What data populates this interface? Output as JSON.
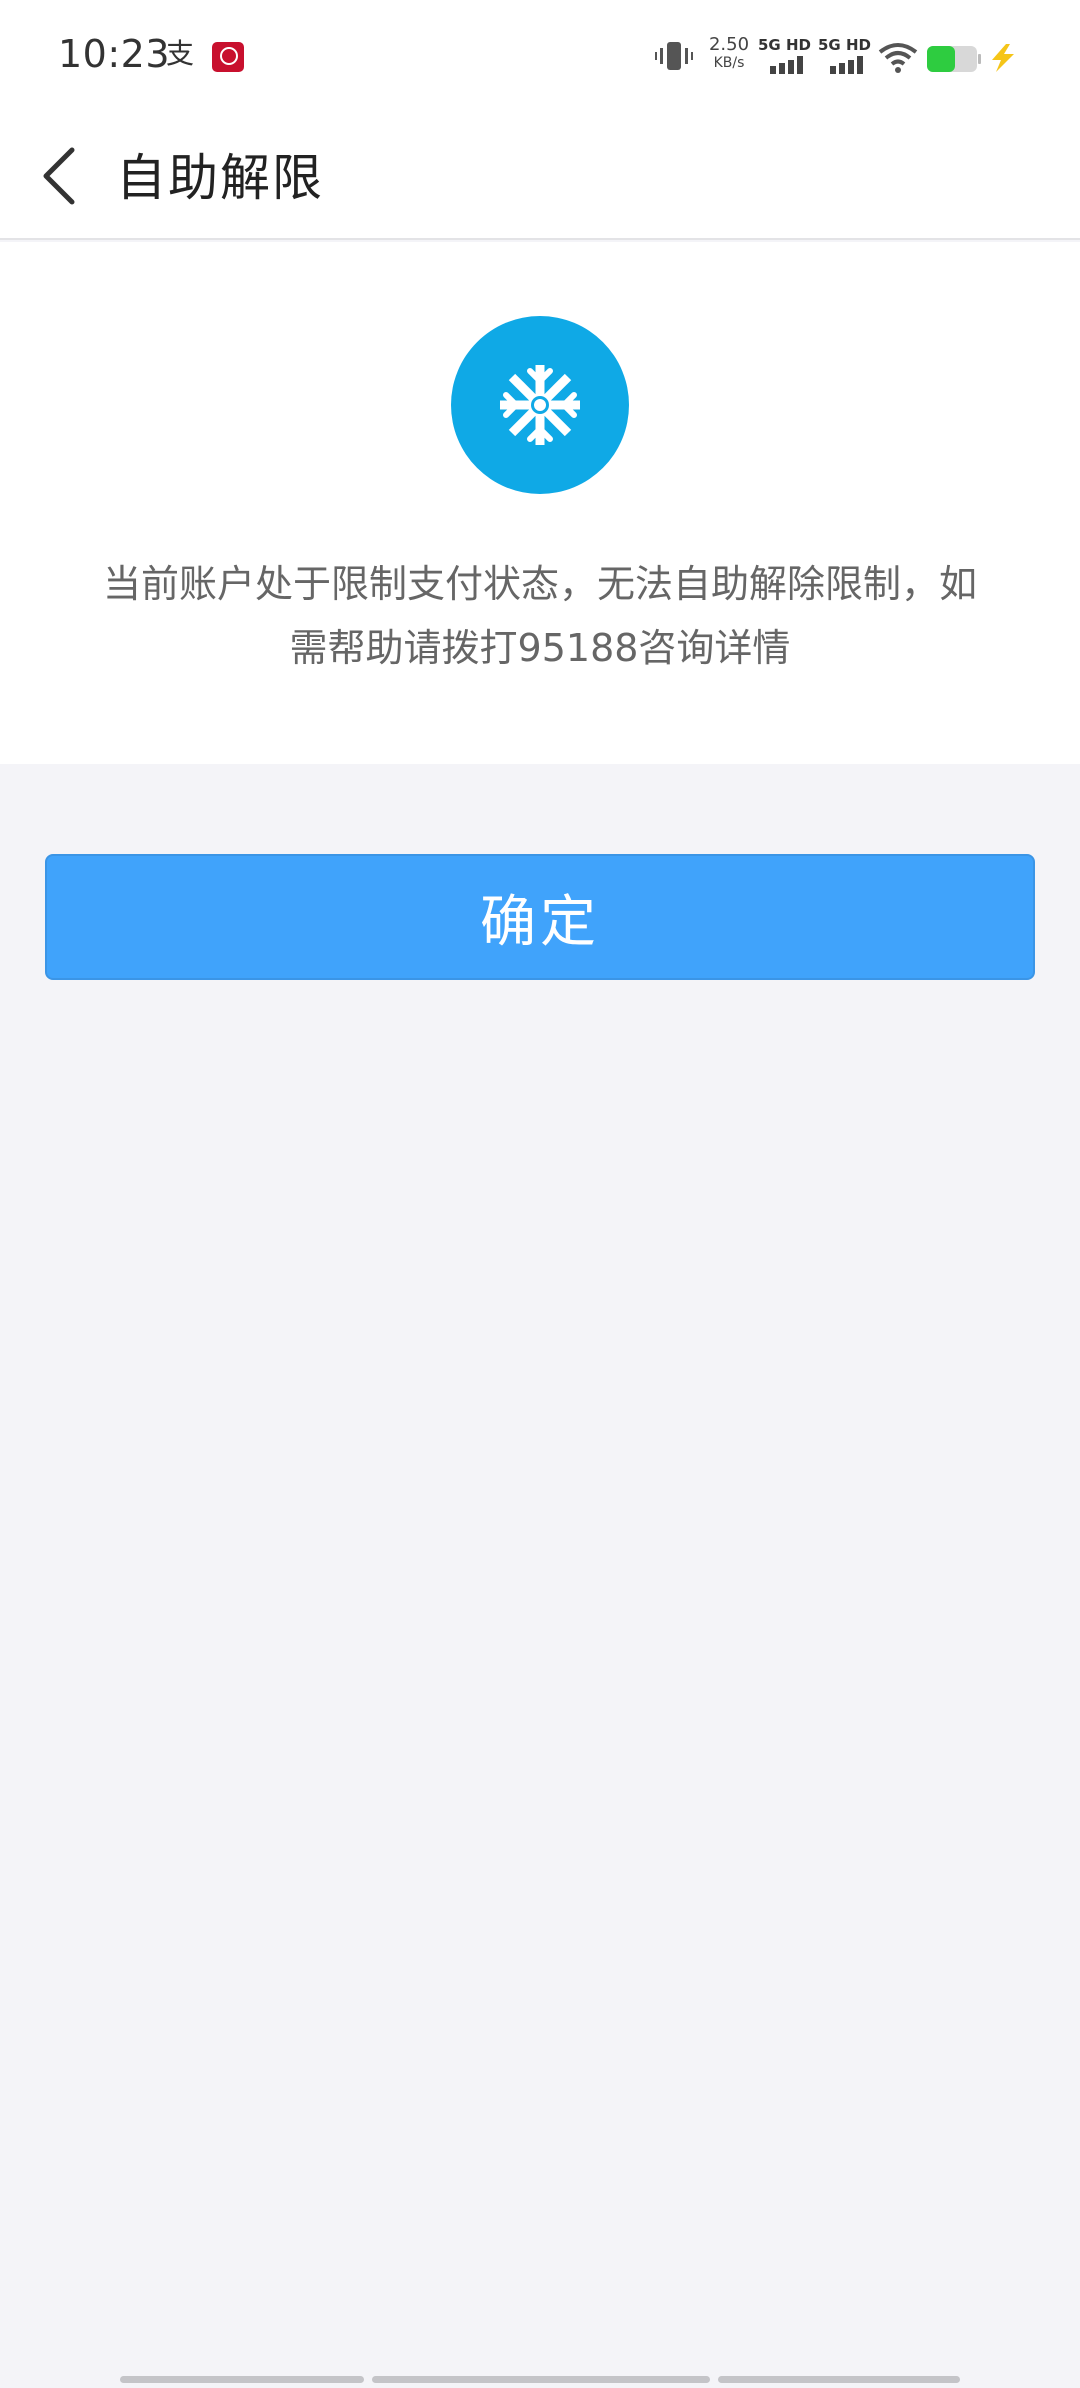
{
  "status_bar": {
    "time": "10:23",
    "notification_alipay": "支",
    "net_speed_value": "2.50",
    "net_speed_unit": "KB/s",
    "signal_1_label": "5G HD",
    "signal_2_label": "5G HD",
    "battery_level": 0.55,
    "colors": {
      "battery": "#2ecc40",
      "charge": "#f5c518"
    }
  },
  "header": {
    "title": "自助解限"
  },
  "card": {
    "icon": "snowflake-icon",
    "icon_color": "#0fa9e6",
    "message": "当前账户处于限制支付状态，无法自助解除限制，如需帮助请拨打95188咨询详情"
  },
  "confirm_button": {
    "label": "确定",
    "color": "#40a3fb"
  }
}
